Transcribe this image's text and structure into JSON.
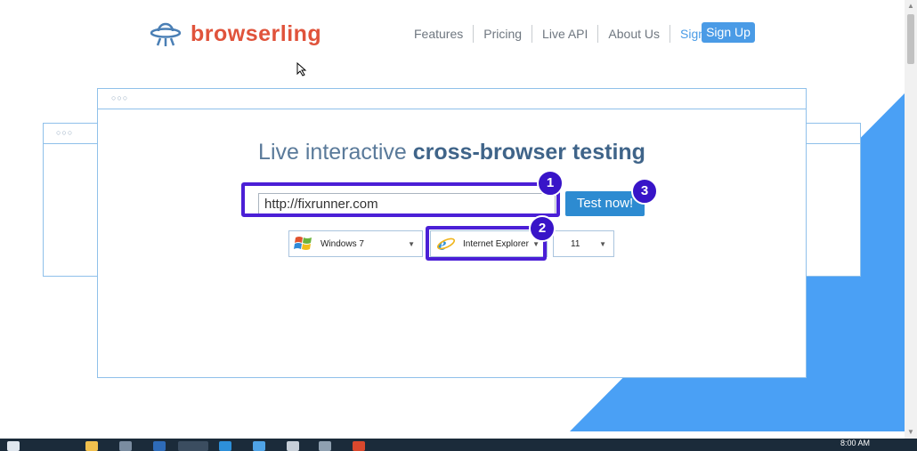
{
  "brand": {
    "name": "browserling"
  },
  "nav": {
    "items": [
      "Features",
      "Pricing",
      "Live API",
      "About Us"
    ],
    "sign_in": "Sign In",
    "sign_up": "Sign Up"
  },
  "hero": {
    "headline_light": "Live interactive ",
    "headline_bold": "cross-browser testing"
  },
  "test_form": {
    "url_value": "http://fixrunner.com",
    "button_label": "Test now!",
    "os": {
      "selected": "Windows 7"
    },
    "browser": {
      "selected": "Internet Explorer"
    },
    "version": {
      "selected": "11"
    }
  },
  "annotations": {
    "badges": [
      "1",
      "2",
      "3"
    ],
    "color": "#4b1fd6"
  },
  "colors": {
    "accent": "#4a9be6",
    "brand": "#e0533b",
    "button": "#2d8bd1",
    "triangle": "#4aa0f5"
  },
  "taskbar": {
    "clock": "8:00 AM"
  }
}
